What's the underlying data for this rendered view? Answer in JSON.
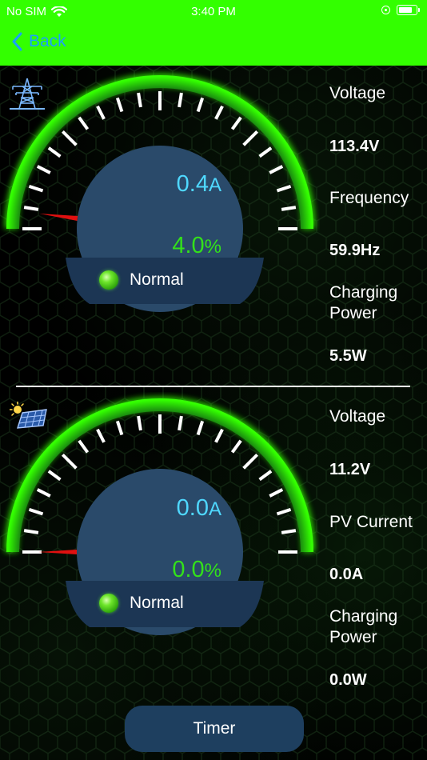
{
  "status_bar": {
    "carrier": "No SIM",
    "time": "3:40 PM"
  },
  "nav": {
    "back_label": "Back"
  },
  "grid_panel": {
    "icon": "power-tower-icon",
    "current_value": "0.4",
    "current_unit": "A",
    "percent_value": "4.0",
    "percent_unit": "%",
    "status": "Normal",
    "needle_fraction": 0.04,
    "metrics": [
      {
        "label": "Voltage",
        "value": "113.4V"
      },
      {
        "label": "Frequency",
        "value": "59.9Hz"
      },
      {
        "label": "Charging\nPower",
        "value": "5.5W"
      }
    ]
  },
  "solar_panel": {
    "icon": "solar-panel-icon",
    "current_value": "0.0",
    "current_unit": "A",
    "percent_value": "0.0",
    "percent_unit": "%",
    "status": "Normal",
    "needle_fraction": 0.0,
    "metrics": [
      {
        "label": "Voltage",
        "value": "11.2V"
      },
      {
        "label": "PV Current",
        "value": "0.0A"
      },
      {
        "label": "Charging\nPower",
        "value": "0.0W"
      }
    ]
  },
  "footer": {
    "timer_label": "Timer"
  },
  "colors": {
    "accent_green": "#33ff00",
    "back_blue": "#1a9fff",
    "current_cyan": "#4fd8ff",
    "percent_green": "#33e11a",
    "dial_fill": "#2a4a6a",
    "needle_red": "#e01010"
  }
}
